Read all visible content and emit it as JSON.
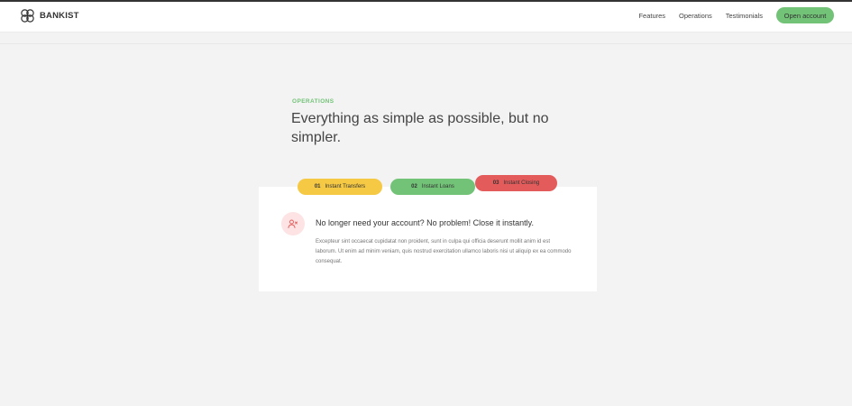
{
  "brand": {
    "name": "BANKIST"
  },
  "nav": {
    "links": [
      "Features",
      "Operations",
      "Testimonials"
    ],
    "cta": "Open account"
  },
  "colors": {
    "accent_green": "#72c377",
    "accent_yellow": "#f5c944",
    "accent_red": "#e35b5b"
  },
  "operations": {
    "label": "OPERATIONS",
    "title": "Everything as simple as possible, but no simpler.",
    "tabs": [
      {
        "num": "01",
        "label": "Instant Transfers"
      },
      {
        "num": "02",
        "label": "Instant Loans"
      },
      {
        "num": "03",
        "label": "Instant Closing"
      }
    ],
    "active": {
      "icon": "user-x-icon",
      "heading": "No longer need your account? No problem! Close it instantly.",
      "text": "Excepteur sint occaecat cupidatat non proident, sunt in culpa qui officia deserunt mollit anim id est laborum. Ut enim ad minim veniam, quis nostrud exercitation ullamco laboris nisi ut aliquip ex ea commodo consequat."
    }
  }
}
